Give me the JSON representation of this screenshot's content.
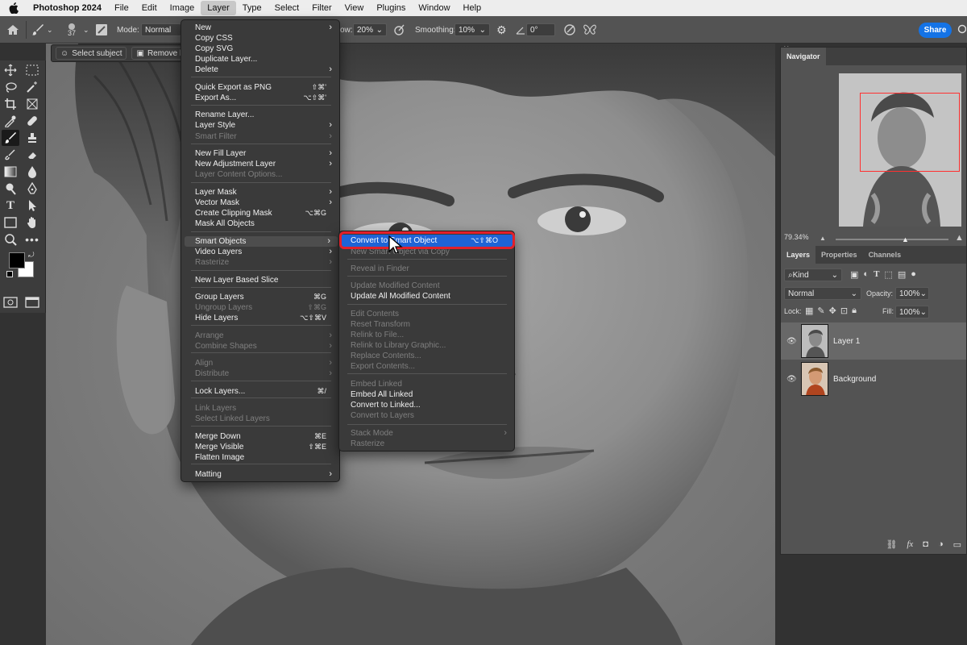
{
  "macbar": {
    "app": "Photoshop 2024",
    "menus": [
      "File",
      "Edit",
      "Image",
      "Layer",
      "Type",
      "Select",
      "Filter",
      "View",
      "Plugins",
      "Window",
      "Help"
    ],
    "open_menu": "Layer"
  },
  "options_bar": {
    "brush_size": "37",
    "mode_label": "Mode:",
    "mode_value": "Normal",
    "flow_label": "ow:",
    "flow_value": "20%",
    "smoothing_label": "Smoothing:",
    "smoothing_value": "10%",
    "angle_value": "0°",
    "share_label": "Share"
  },
  "task_bar": {
    "select_subject": "Select subject",
    "remove_bg": "Remove b"
  },
  "layer_menu": {
    "items": [
      {
        "label": "New",
        "arrow": true
      },
      {
        "label": "Copy CSS"
      },
      {
        "label": "Copy SVG"
      },
      {
        "label": "Duplicate Layer..."
      },
      {
        "label": "Delete",
        "arrow": true
      },
      {
        "label": "Quick Export as PNG",
        "shortcut": "⇧⌘'"
      },
      {
        "label": "Export As...",
        "shortcut": "⌥⇧⌘'"
      },
      {
        "label": "Rename Layer..."
      },
      {
        "label": "Layer Style",
        "arrow": true
      },
      {
        "label": "Smart Filter",
        "disabled": true,
        "arrow": true
      },
      {
        "label": "New Fill Layer",
        "arrow": true
      },
      {
        "label": "New Adjustment Layer",
        "arrow": true
      },
      {
        "label": "Layer Content Options...",
        "disabled": true
      },
      {
        "label": "Layer Mask",
        "arrow": true
      },
      {
        "label": "Vector Mask",
        "arrow": true
      },
      {
        "label": "Create Clipping Mask",
        "shortcut": "⌥⌘G"
      },
      {
        "label": "Mask All Objects"
      },
      {
        "label": "Smart Objects",
        "arrow": true,
        "highlighted": true
      },
      {
        "label": "Video Layers",
        "arrow": true
      },
      {
        "label": "Rasterize",
        "disabled": true,
        "arrow": true
      },
      {
        "label": "New Layer Based Slice"
      },
      {
        "label": "Group Layers",
        "shortcut": "⌘G"
      },
      {
        "label": "Ungroup Layers",
        "shortcut": "⇧⌘G",
        "disabled": true
      },
      {
        "label": "Hide Layers",
        "shortcut": "⌥⇧⌘V"
      },
      {
        "label": "Arrange",
        "disabled": true,
        "arrow": true
      },
      {
        "label": "Combine Shapes",
        "disabled": true,
        "arrow": true
      },
      {
        "label": "Align",
        "disabled": true,
        "arrow": true
      },
      {
        "label": "Distribute",
        "disabled": true,
        "arrow": true
      },
      {
        "label": "Lock Layers...",
        "shortcut": "⌘/"
      },
      {
        "label": "Link Layers",
        "disabled": true
      },
      {
        "label": "Select Linked Layers",
        "disabled": true
      },
      {
        "label": "Merge Down",
        "shortcut": "⌘E"
      },
      {
        "label": "Merge Visible",
        "shortcut": "⇧⌘E"
      },
      {
        "label": "Flatten Image"
      },
      {
        "label": "Matting",
        "arrow": true
      }
    ]
  },
  "smart_objects_menu": {
    "convert_label": "Convert to Smart Object",
    "convert_shortcut": "⌥⇧⌘O",
    "items": [
      {
        "label": "New Smart Object via Copy",
        "disabled": true
      },
      {
        "label": "Reveal in Finder",
        "disabled": true
      },
      {
        "label": "Update Modified Content",
        "disabled": true
      },
      {
        "label": "Update All Modified Content"
      },
      {
        "label": "Edit Contents",
        "disabled": true
      },
      {
        "label": "Reset Transform",
        "disabled": true
      },
      {
        "label": "Relink to File...",
        "disabled": true
      },
      {
        "label": "Relink to Library Graphic...",
        "disabled": true
      },
      {
        "label": "Replace Contents...",
        "disabled": true
      },
      {
        "label": "Export Contents...",
        "disabled": true
      },
      {
        "label": "Embed Linked",
        "disabled": true
      },
      {
        "label": "Embed All Linked"
      },
      {
        "label": "Convert to Linked..."
      },
      {
        "label": "Convert to Layers",
        "disabled": true
      },
      {
        "label": "Stack Mode",
        "disabled": true,
        "arrow": true
      },
      {
        "label": "Rasterize",
        "disabled": true
      }
    ]
  },
  "navigator": {
    "tab": "Navigator",
    "zoom": "79.34%"
  },
  "layers_panel": {
    "tabs": [
      "Layers",
      "Properties",
      "Channels"
    ],
    "kind_label": "Kind",
    "blend_mode": "Normal",
    "opacity_label": "Opacity:",
    "opacity_value": "100%",
    "lock_label": "Lock:",
    "fill_label": "Fill:",
    "fill_value": "100%",
    "layers": [
      {
        "name": "Layer 1",
        "selected": true
      },
      {
        "name": "Background",
        "selected": false
      }
    ]
  },
  "colors": {
    "highlight": "#1f63d6",
    "callout_ring": "#e3202a",
    "share_button": "#1473e6",
    "nav_rect": "#ff3030"
  }
}
